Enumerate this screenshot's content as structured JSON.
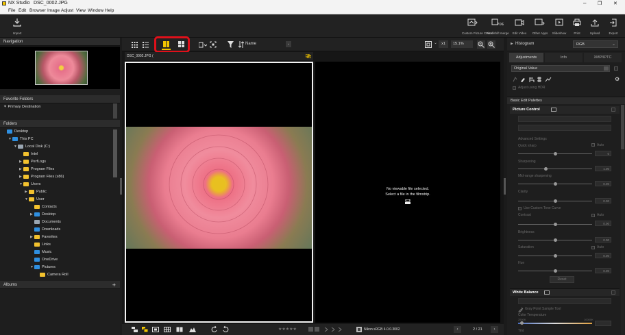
{
  "titlebar": {
    "app": "NX Studio",
    "file": "DSC_0002.JPG",
    "minimize": "–",
    "maximize": "❐",
    "close": "✕"
  },
  "menu": [
    "File",
    "Edit",
    "Browser",
    "Image",
    "Adjust",
    "View",
    "Window",
    "Help"
  ],
  "toolbar": {
    "import": "Import",
    "right_buttons": [
      "Custom Picture Control",
      "Pixel shift merge",
      "Edit Video",
      "Other Apps",
      "Slideshow",
      "Print",
      "Upload",
      "Export"
    ]
  },
  "left": {
    "navigation": "Navigation",
    "favorites": "Favorite Folders",
    "favorite_item": "Primary Destination",
    "folders": "Folders",
    "tree": [
      {
        "label": "Desktop",
        "indent": 0,
        "icon": "blue",
        "arrow": ""
      },
      {
        "label": "This PC",
        "indent": 1,
        "icon": "blue",
        "arrow": "▼"
      },
      {
        "label": "Local Disk (C:)",
        "indent": 2,
        "icon": "grey",
        "arrow": "▼"
      },
      {
        "label": "Intel",
        "indent": 3,
        "icon": "yellow",
        "arrow": ""
      },
      {
        "label": "PerfLogs",
        "indent": 3,
        "icon": "yellow",
        "arrow": "▶"
      },
      {
        "label": "Program Files",
        "indent": 3,
        "icon": "yellow",
        "arrow": "▶"
      },
      {
        "label": "Program Files (x86)",
        "indent": 3,
        "icon": "yellow",
        "arrow": "▶"
      },
      {
        "label": "Users",
        "indent": 3,
        "icon": "yellow",
        "arrow": "▼"
      },
      {
        "label": "Public",
        "indent": 4,
        "icon": "yellow",
        "arrow": "▶"
      },
      {
        "label": "User",
        "indent": 4,
        "icon": "yellow",
        "arrow": "▼"
      },
      {
        "label": "Contacts",
        "indent": 5,
        "icon": "yellow",
        "arrow": ""
      },
      {
        "label": "Desktop",
        "indent": 5,
        "icon": "blue",
        "arrow": "▶"
      },
      {
        "label": "Documents",
        "indent": 5,
        "icon": "grey",
        "arrow": ""
      },
      {
        "label": "Downloads",
        "indent": 5,
        "icon": "blue",
        "arrow": ""
      },
      {
        "label": "Favorites",
        "indent": 5,
        "icon": "yellow",
        "arrow": "▶"
      },
      {
        "label": "Links",
        "indent": 5,
        "icon": "yellow",
        "arrow": ""
      },
      {
        "label": "Music",
        "indent": 5,
        "icon": "blue",
        "arrow": ""
      },
      {
        "label": "OneDrive",
        "indent": 5,
        "icon": "blue",
        "arrow": ""
      },
      {
        "label": "Pictures",
        "indent": 5,
        "icon": "blue",
        "arrow": "▼"
      },
      {
        "label": "Camera Roll",
        "indent": 6,
        "icon": "yellow",
        "arrow": ""
      }
    ],
    "albums": "Albums",
    "albums_add": "+"
  },
  "center": {
    "sort_label": "Name",
    "zoom_x": "x1",
    "zoom_pct": "15.1%",
    "viewer1_title": "DSC_0002.JPG (",
    "no_file_line1": "No viewable file selected.",
    "no_file_line2": "Select a file in the filmstrip.",
    "stars": "★★★★★",
    "profile": "Nikon sRGB 4.0.0.3002",
    "page": "2 / 21"
  },
  "right": {
    "histogram": "Histogram",
    "histogram_mode": "RGB",
    "tabs": [
      "Adjustments",
      "Info",
      "XMP/IPTC"
    ],
    "original_value": "Original Value",
    "adjust_hdr": "Adjust using HDR",
    "basic_palettes": "Basic Edit Palettes",
    "picture_control": "Picture Control",
    "advanced": "Advanced Settings",
    "quick_sharp": "Quick sharp",
    "sharpening": "Sharpening",
    "midrange": "Mid-range sharpening",
    "clarity": "Clarity",
    "custom_tone": "Use Custom Tone Curve",
    "contrast": "Contrast",
    "brightness": "Brightness",
    "saturation": "Saturation",
    "hue": "Hue",
    "auto": "Auto",
    "reset": "Reset",
    "white_balance": "White Balance",
    "gray_point": "Gray Point Sample Tool",
    "color_temp": "Color Temperature",
    "tint": "Tint",
    "val_zero": "0",
    "val_sharp": "1.00",
    "val_mid": "0.00",
    "val_clar": "0.00",
    "val_bright": "0.00",
    "val_sat": "0.00",
    "val_hue": "0.00",
    "val_contrast": "0.00",
    "temp_min": "2500K",
    "temp_max": "10000K"
  }
}
